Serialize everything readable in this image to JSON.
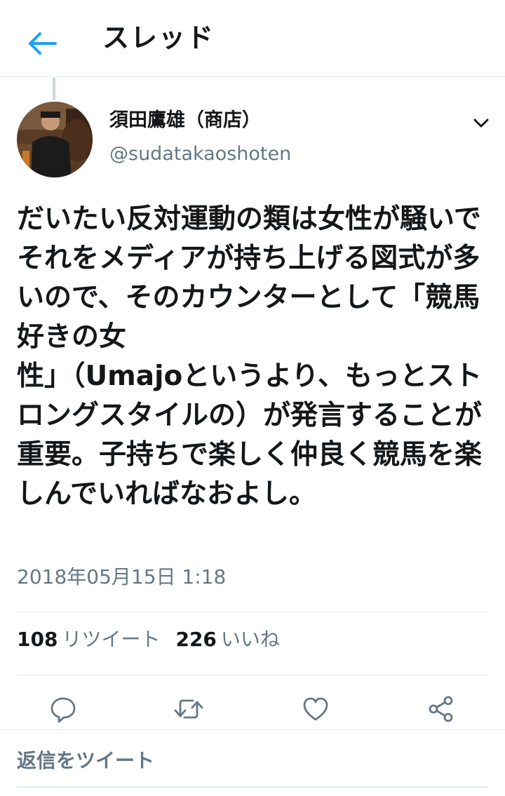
{
  "header": {
    "title": "スレッド",
    "back_icon": "arrow-left-icon",
    "accent_color": "#1da1f2"
  },
  "tweet": {
    "author_name": "須田鷹雄（商店）",
    "author_handle": "@sudatakaoshoten",
    "text": "だいたい反対運動の類は女性が騒いでそれをメディアが持ち上げる図式が多いので、そのカウンターとして「競馬好きの女\n性」（Umajoというより、もっとストロングスタイルの）が発言することが重要。子持ちで楽しく仲良く競馬を楽しんでいればなおよし。",
    "timestamp": "2018年05月15日 1:18",
    "retweet_count": "108",
    "retweet_label": "リツイート",
    "like_count": "226",
    "like_label": "いいね"
  },
  "actions": [
    {
      "name": "reply",
      "icon": "comment-icon"
    },
    {
      "name": "retweet",
      "icon": "retweet-icon"
    },
    {
      "name": "like",
      "icon": "heart-icon"
    },
    {
      "name": "share",
      "icon": "share-icon"
    }
  ],
  "reply": {
    "placeholder": "返信をツイート"
  },
  "colors": {
    "text": "#14171a",
    "secondary": "#657786",
    "divider": "#e1e8ed",
    "accent": "#1da1f2"
  }
}
